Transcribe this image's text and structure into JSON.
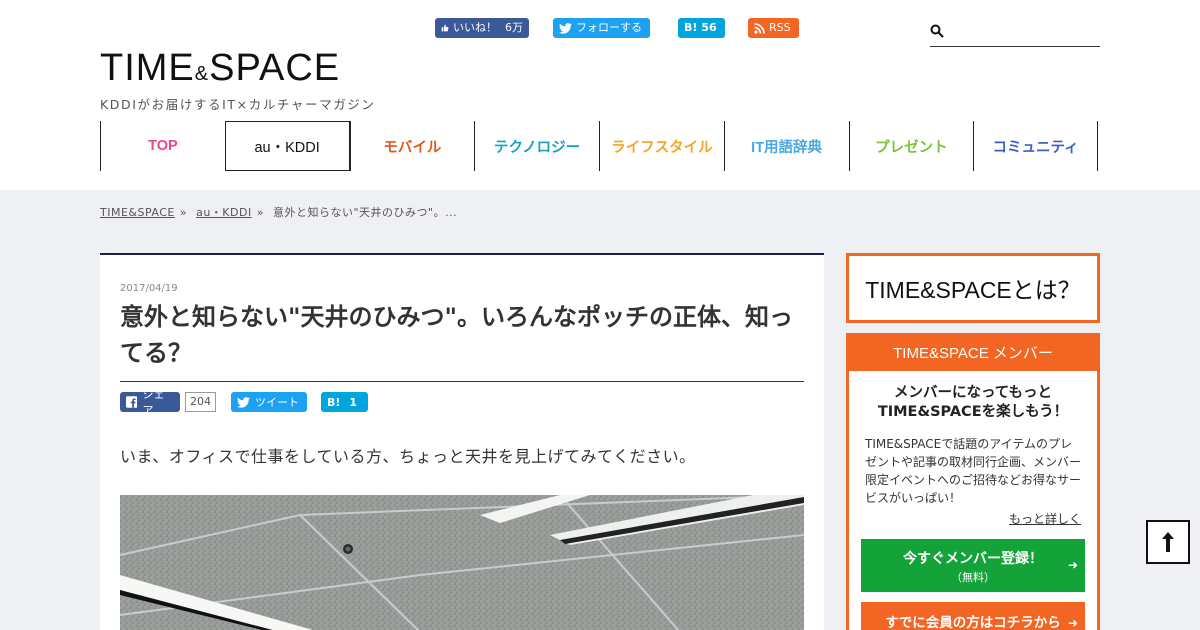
{
  "header": {
    "logo_main": "TIME",
    "logo_amp": "&",
    "logo_main2": "SPACE",
    "tagline": "KDDIがお届けするIT×カルチャーマガジン",
    "social": {
      "facebook_label": "いいね！",
      "facebook_count": "6万",
      "twitter_label": "フォローする",
      "hatena_label": "B!",
      "hatena_count": "56",
      "rss_label": "RSS"
    },
    "search": {
      "placeholder": ""
    }
  },
  "nav": {
    "items": [
      {
        "label": "TOP",
        "color": "#e8458b"
      },
      {
        "label": "au・KDDI",
        "color": "#111111"
      },
      {
        "label": "モバイル",
        "color": "#e05a1a"
      },
      {
        "label": "テクノロジー",
        "color": "#1aa0c0"
      },
      {
        "label": "ライフスタイル",
        "color": "#f5a623"
      },
      {
        "label": "IT用語辞典",
        "color": "#4aa8e0"
      },
      {
        "label": "プレゼント",
        "color": "#7dc23c"
      },
      {
        "label": "コミュニティ",
        "color": "#3c5fc8"
      }
    ]
  },
  "breadcrumb": {
    "home": "TIME&SPACE",
    "category": "au・KDDI",
    "current": "意外と知らない\"天井のひみつ\"。..."
  },
  "article": {
    "date": "2017/04/19",
    "title": "意外と知らない\"天井のひみつ\"。いろんなポッチの正体、知ってる？",
    "share": {
      "fb_label": "シェア",
      "fb_count": "204",
      "tw_label": "ツイート",
      "hb_label": "B!",
      "hb_count": "1"
    },
    "lead": "いま、オフィスで仕事をしている方、ちょっと天井を見上げてみてください。"
  },
  "sidebar": {
    "about_title": "TIME&SPACEとは？",
    "member_head": "TIME&SPACE メンバー",
    "member_lead_1": "メンバーになってもっと",
    "member_lead_2": "TIME&SPACEを楽しもう！",
    "member_body": "TIME&SPACEで話題のアイテムのプレゼントや記事の取材同行企画、メンバー限定イベントへのご招待などお得なサービスがいっぱい！",
    "more_link": "もっと詳しく",
    "register_label": "今すぐメンバー登録！",
    "register_sub": "（無料）",
    "login_label": "すでに会員の方はコチラから"
  },
  "to_top_icon": "arrow-up-icon"
}
